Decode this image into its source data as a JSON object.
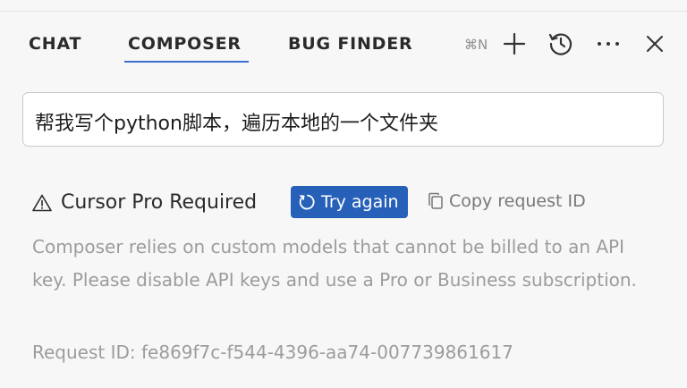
{
  "tabs": [
    {
      "label": "CHAT"
    },
    {
      "label": "COMPOSER",
      "active": true
    },
    {
      "label": "BUG FINDER"
    }
  ],
  "toolbar": {
    "shortcut_hint": "⌘N",
    "icons": [
      "plus-icon",
      "history-icon",
      "more-icon",
      "close-icon"
    ]
  },
  "prompt": {
    "text": "帮我写个python脚本，遍历本地的一个文件夹"
  },
  "error": {
    "title": "Cursor Pro Required",
    "retry_label": "Try again",
    "copy_label": "Copy request ID",
    "description": "Composer relies on custom models that cannot be billed to an API key. Please disable API keys and use a Pro or Business subscription.",
    "request_id": "Request ID: fe869f7c-f544-4396-aa74-007739861617"
  },
  "colors": {
    "accent": "#2660b8",
    "tab_underline": "#3b6fd1",
    "muted_text": "#9c9c9c"
  }
}
